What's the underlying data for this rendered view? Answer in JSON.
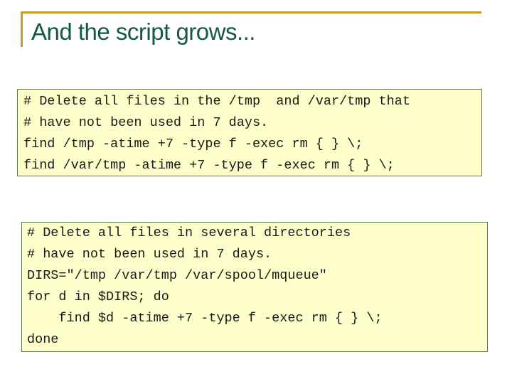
{
  "slide": {
    "title": "And the script grows...",
    "accent_color": "#C09A2A",
    "title_color": "#145A3C",
    "code_background": "#FFFFCC"
  },
  "code_blocks": [
    {
      "lines": [
        "# Delete all files in the /tmp  and /var/tmp that",
        "# have not been used in 7 days.",
        "find /tmp -atime +7 -type f -exec rm { } \\;",
        "find /var/tmp -atime +7 -type f -exec rm { } \\;"
      ]
    },
    {
      "lines": [
        "# Delete all files in several directories",
        "# have not been used in 7 days.",
        "DIRS=\"/tmp /var/tmp /var/spool/mqueue\"",
        "for d in $DIRS; do",
        "    find $d -atime +7 -type f -exec rm { } \\;",
        "done"
      ]
    }
  ]
}
